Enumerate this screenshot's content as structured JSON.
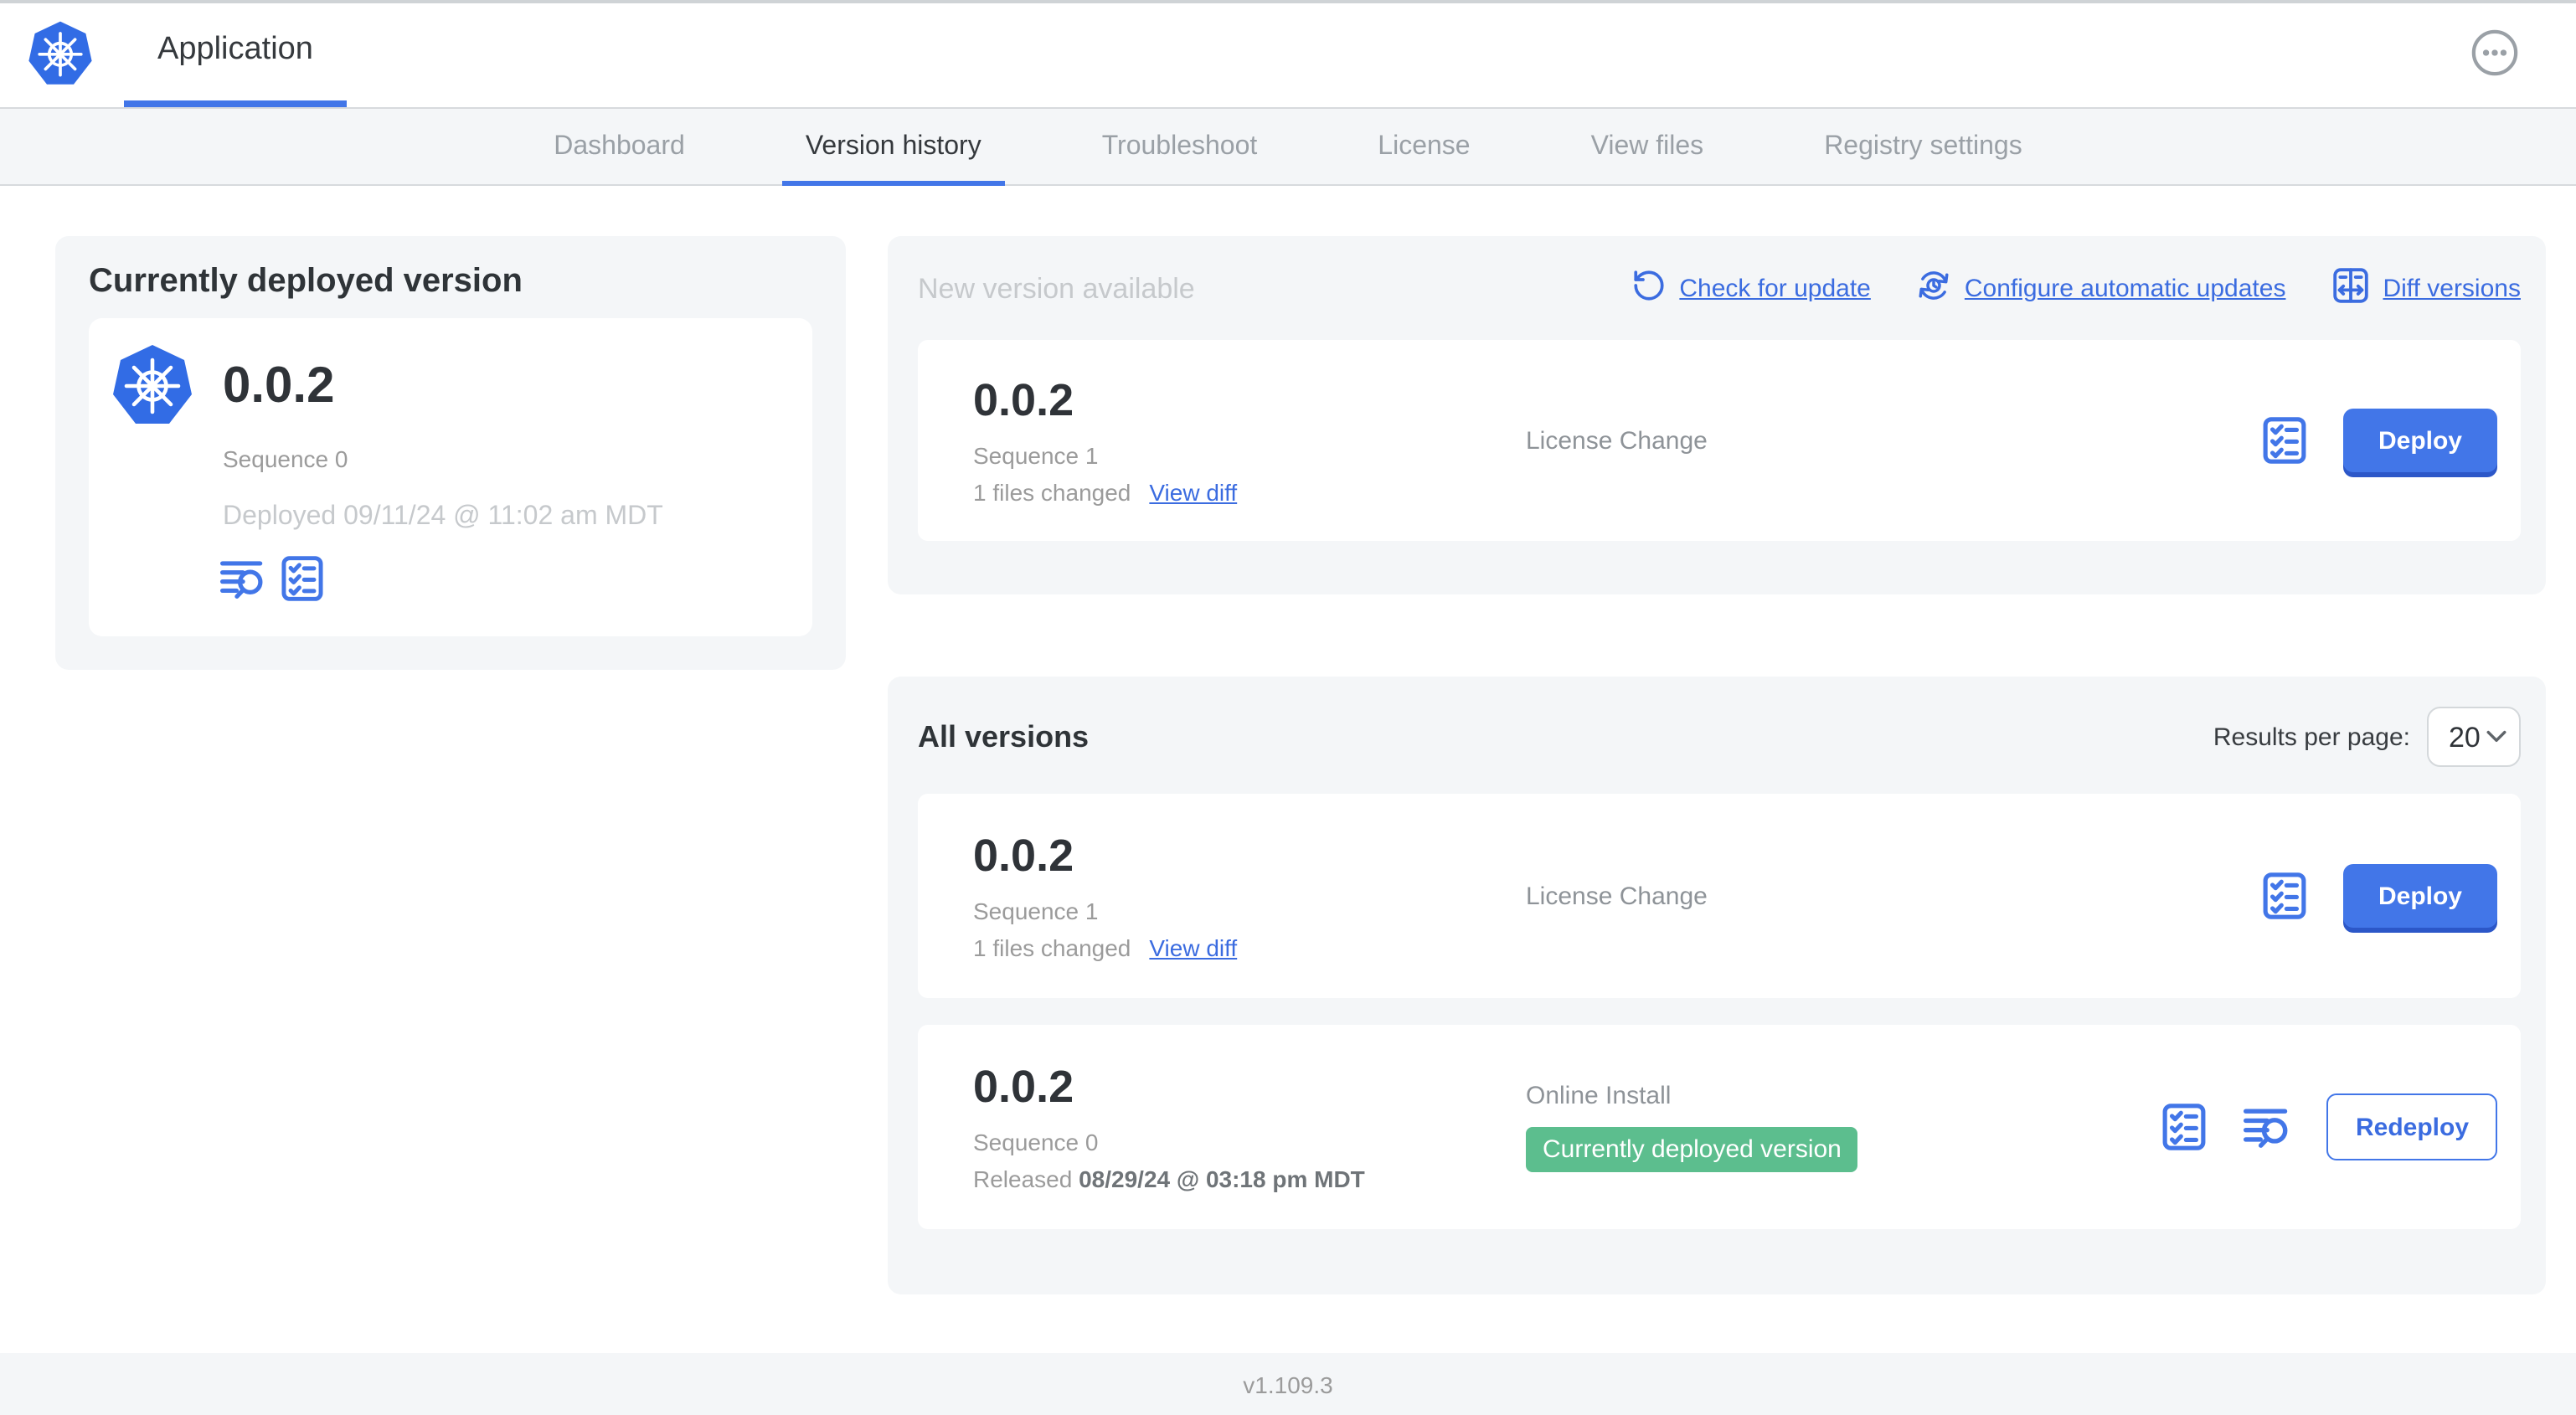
{
  "colors": {
    "accent_blue": "#4276e8",
    "link_blue": "#3b6ce0",
    "k8s_blue": "#326ce5",
    "badge_green": "#5cbe8e",
    "panel_gray": "#f4f6f8"
  },
  "header": {
    "app_title": "Application",
    "menu_icon": "ellipsis-icon"
  },
  "nav": {
    "tabs": [
      {
        "label": "Dashboard",
        "active": false
      },
      {
        "label": "Version history",
        "active": true
      },
      {
        "label": "Troubleshoot",
        "active": false
      },
      {
        "label": "License",
        "active": false
      },
      {
        "label": "View files",
        "active": false
      },
      {
        "label": "Registry settings",
        "active": false
      }
    ]
  },
  "current": {
    "title": "Currently deployed version",
    "version": "0.0.2",
    "sequence": "Sequence 0",
    "deployed": "Deployed 09/11/24 @ 11:02 am MDT",
    "icons": [
      "view-logs-icon",
      "checklist-icon"
    ]
  },
  "new_version": {
    "title": "New version available",
    "links": [
      {
        "label": "Check for update",
        "icon": "refresh-icon"
      },
      {
        "label": "Configure automatic updates",
        "icon": "schedule-update-icon"
      },
      {
        "label": "Diff versions",
        "icon": "diff-icon"
      }
    ],
    "row": {
      "version": "0.0.2",
      "sequence": "Sequence 1",
      "files_changed": "1 files changed",
      "view_diff_label": "View diff",
      "source": "License Change",
      "action_label": "Deploy"
    }
  },
  "all_versions": {
    "title": "All versions",
    "results_per_page_label": "Results per page:",
    "results_per_page_value": "20",
    "rows": [
      {
        "version": "0.0.2",
        "sequence": "Sequence 1",
        "files_changed": "1 files changed",
        "view_diff_label": "View diff",
        "source": "License Change",
        "action_label": "Deploy"
      },
      {
        "version": "0.0.2",
        "sequence": "Sequence 0",
        "released_prefix": "Released",
        "released_date": "08/29/24 @ 03:18 pm MDT",
        "source": "Online Install",
        "badge": "Currently deployed version",
        "action_label": "Redeploy"
      }
    ]
  },
  "footer": {
    "version": "v1.109.3"
  }
}
